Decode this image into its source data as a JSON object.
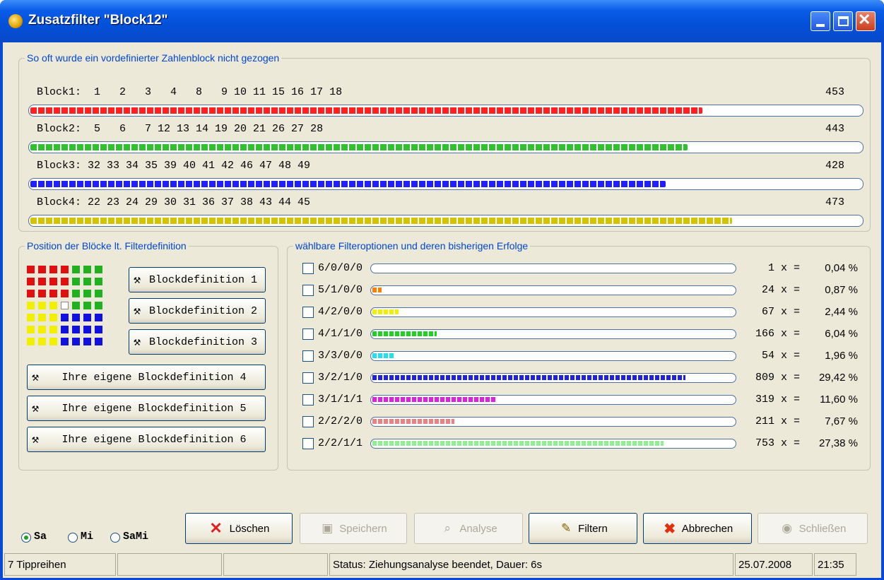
{
  "window": {
    "title": "Zusatzfilter \"Block12\""
  },
  "block_group": {
    "title": "So oft wurde ein vordefinierter Zahlenblock nicht gezogen",
    "blocks": [
      {
        "label": "Block1:  1   2   3   4   8   9 10 11 15 16 17 18",
        "count": "453",
        "value": 453,
        "color": "#ff2020"
      },
      {
        "label": "Block2:  5   6   7 12 13 14 19 20 21 26 27 28",
        "count": "443",
        "value": 443,
        "color": "#30c030"
      },
      {
        "label": "Block3: 32 33 34 35 39 40 41 42 46 47 48 49",
        "count": "428",
        "value": 428,
        "color": "#2020ff"
      },
      {
        "label": "Block4: 22 23 24 29 30 31 36 37 38 43 44 45",
        "count": "473",
        "value": 473,
        "color": "#d4c400"
      }
    ]
  },
  "position_group": {
    "title": "Position der Blöcke lt. Filterdefinition",
    "buttons": [
      "Blockdefinition 1",
      "Blockdefinition 2",
      "Blockdefinition 3",
      "Ihre eigene Blockdefinition 4",
      "Ihre eigene Blockdefinition 5",
      "Ihre eigene Blockdefinition 6"
    ]
  },
  "options_group": {
    "title": "wählbare Filteroptionen und deren bisherigen Erfolge",
    "options": [
      {
        "name": "6/0/0/0",
        "count": "1 x =",
        "pct": "0,04 %",
        "value": 0.04,
        "color": "#ff8000"
      },
      {
        "name": "5/1/0/0",
        "count": "24 x =",
        "pct": "0,87 %",
        "value": 0.87,
        "color": "#ff8000"
      },
      {
        "name": "4/2/0/0",
        "count": "67 x =",
        "pct": "2,44 %",
        "value": 2.44,
        "color": "#f0f000"
      },
      {
        "name": "4/1/1/0",
        "count": "166 x =",
        "pct": "6,04 %",
        "value": 6.04,
        "color": "#20d020"
      },
      {
        "name": "3/3/0/0",
        "count": "54 x =",
        "pct": "1,96 %",
        "value": 1.96,
        "color": "#20e0f0"
      },
      {
        "name": "3/2/1/0",
        "count": "809 x =",
        "pct": "29,42 %",
        "value": 29.42,
        "color": "#2020e0"
      },
      {
        "name": "3/1/1/1",
        "count": "319 x =",
        "pct": "11,60 %",
        "value": 11.6,
        "color": "#e020e0"
      },
      {
        "name": "2/2/2/0",
        "count": "211 x =",
        "pct": "7,67 %",
        "value": 7.67,
        "color": "#f08080"
      },
      {
        "name": "2/2/1/1",
        "count": "753 x =",
        "pct": "27,38 %",
        "value": 27.38,
        "color": "#90f090"
      }
    ]
  },
  "radios": {
    "sa": "Sa",
    "mi": "Mi",
    "sami": "SaMi",
    "selected": "Sa"
  },
  "actions": {
    "loeschen": "Löschen",
    "speichern": "Speichern",
    "analyse": "Analyse",
    "filtern": "Filtern",
    "abbrechen": "Abbrechen",
    "schliessen": "Schließen"
  },
  "status": {
    "tippreihen": "7 Tippreihen",
    "message": "Status: Ziehungsanalyse beendet, Dauer: 6s",
    "date": "25.07.2008",
    "time": "21:35"
  }
}
